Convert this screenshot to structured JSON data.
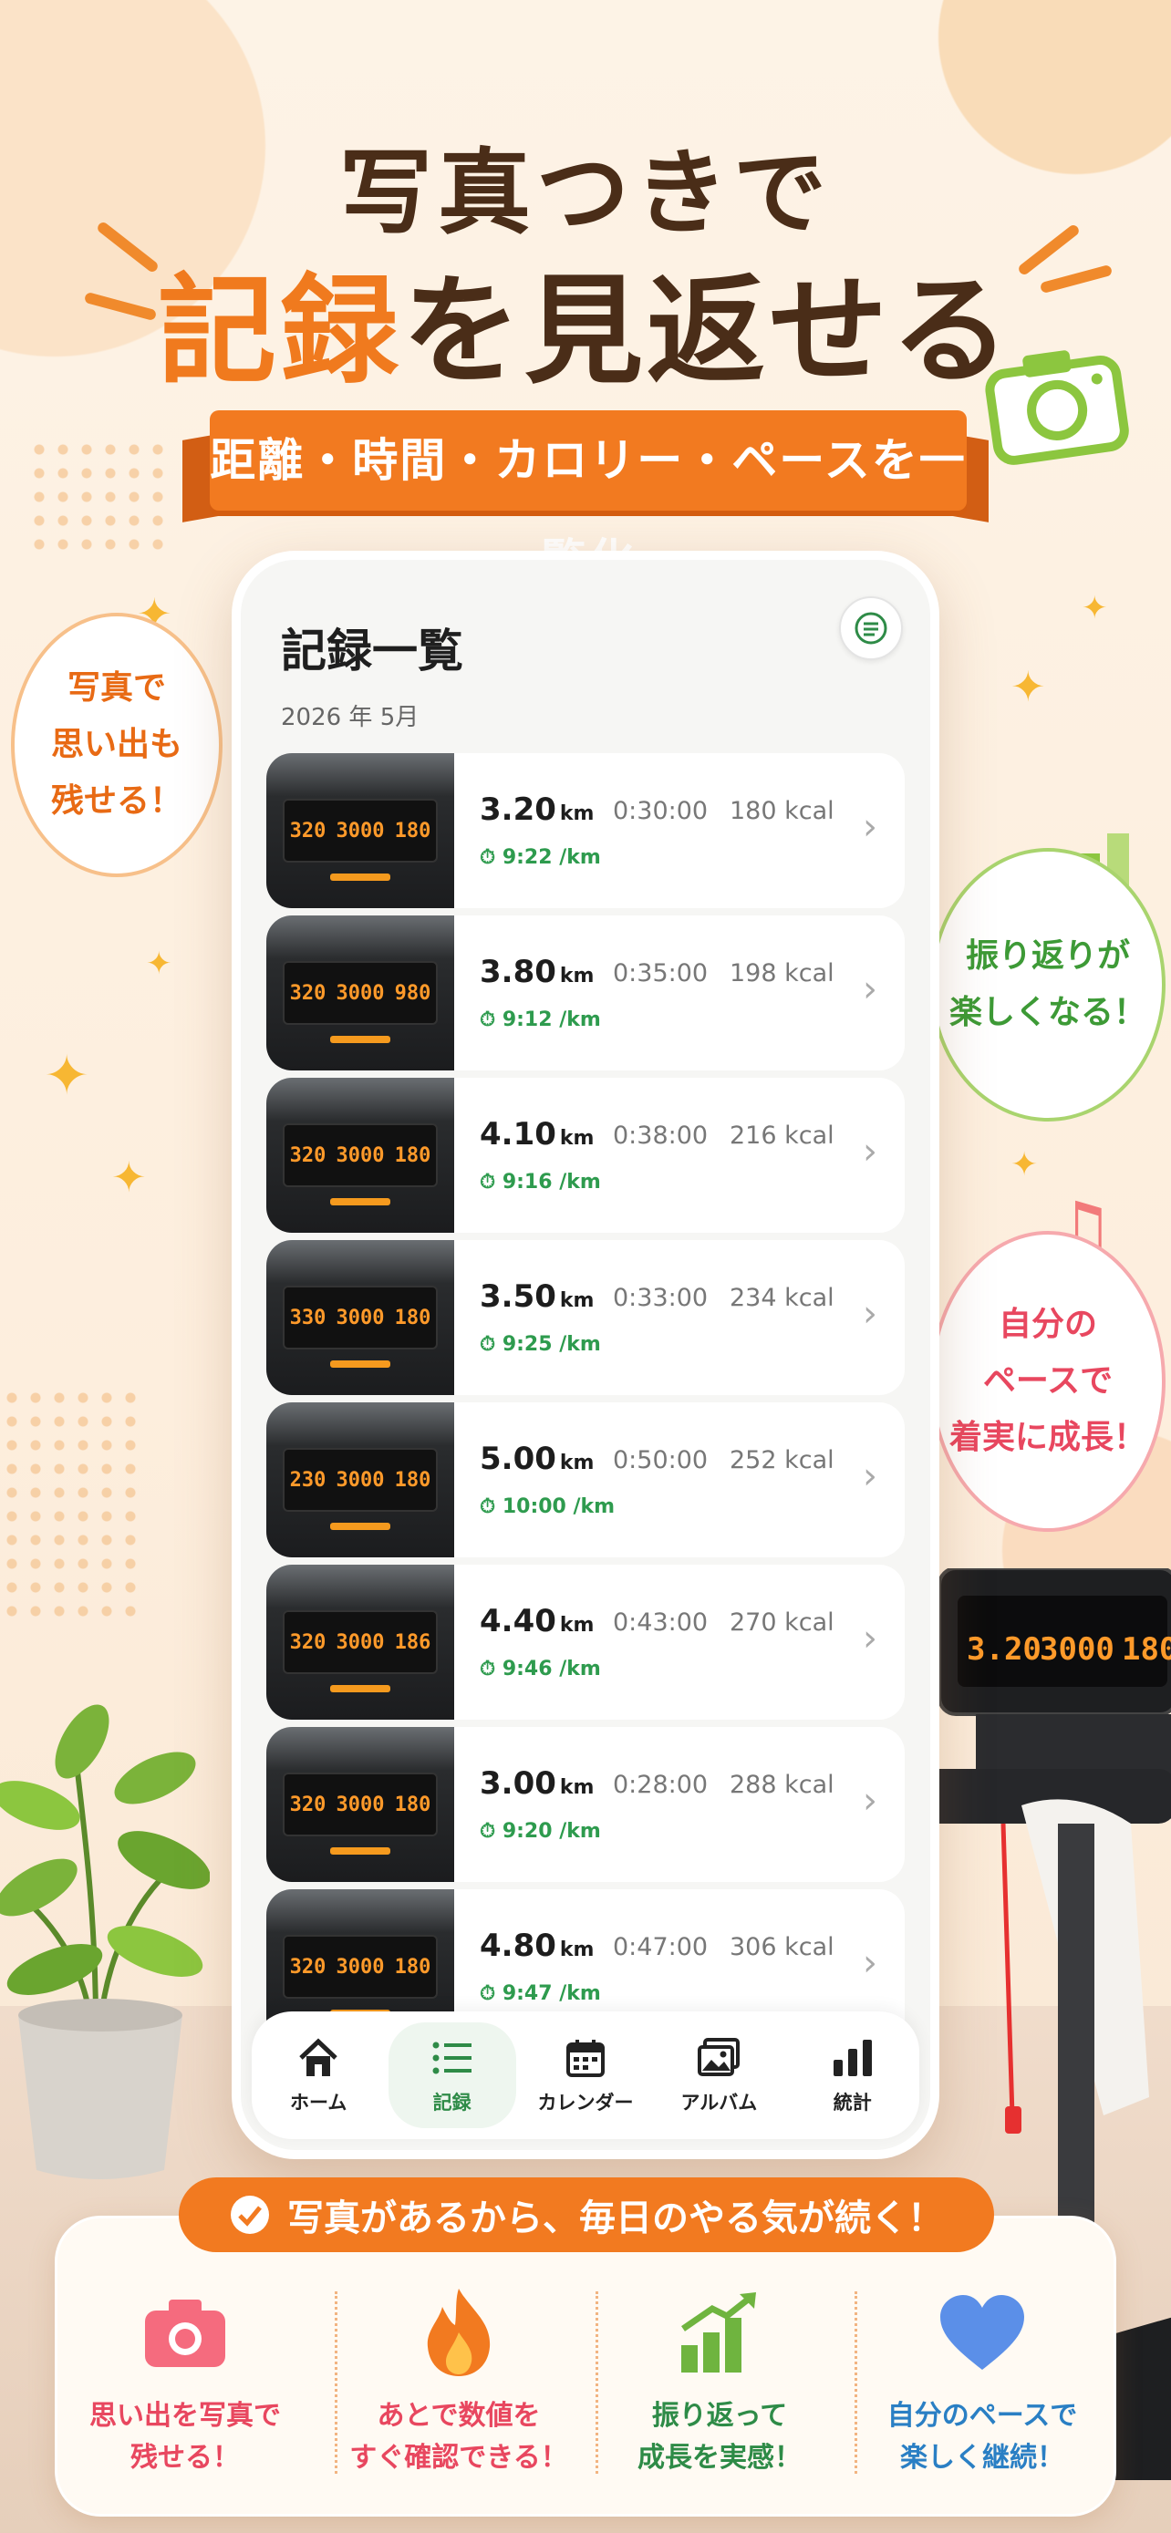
{
  "hero": {
    "line1": "写真つきで",
    "line2_accent": "記録",
    "line2_rest": "を見返せる",
    "ribbon": "距離・時間・カロリー・ペースを一覧化"
  },
  "bubbles": {
    "left": [
      "写真で",
      "思い出も",
      "残せる！"
    ],
    "right_top": [
      "振り返りが",
      "楽しくなる！"
    ],
    "right_bottom": [
      "自分の",
      "ペースで",
      "着実に成長！"
    ]
  },
  "app": {
    "title": "記録一覧",
    "month": "2026 年 5月",
    "records": [
      {
        "distance": "3.20",
        "unit": "km",
        "time": "0:30:00",
        "kcal": "180 kcal",
        "pace": "9:22 /km",
        "panel": [
          "320",
          "3000",
          "180"
        ]
      },
      {
        "distance": "3.80",
        "unit": "km",
        "time": "0:35:00",
        "kcal": "198 kcal",
        "pace": "9:12 /km",
        "panel": [
          "320",
          "3000",
          "980"
        ]
      },
      {
        "distance": "4.10",
        "unit": "km",
        "time": "0:38:00",
        "kcal": "216 kcal",
        "pace": "9:16 /km",
        "panel": [
          "320",
          "3000",
          "180"
        ]
      },
      {
        "distance": "3.50",
        "unit": "km",
        "time": "0:33:00",
        "kcal": "234 kcal",
        "pace": "9:25 /km",
        "panel": [
          "330",
          "3000",
          "180"
        ]
      },
      {
        "distance": "5.00",
        "unit": "km",
        "time": "0:50:00",
        "kcal": "252 kcal",
        "pace": "10:00 /km",
        "panel": [
          "230",
          "3000",
          "180"
        ]
      },
      {
        "distance": "4.40",
        "unit": "km",
        "time": "0:43:00",
        "kcal": "270 kcal",
        "pace": "9:46 /km",
        "panel": [
          "320",
          "3000",
          "186"
        ]
      },
      {
        "distance": "3.00",
        "unit": "km",
        "time": "0:28:00",
        "kcal": "288 kcal",
        "pace": "9:20 /km",
        "panel": [
          "320",
          "3000",
          "180"
        ]
      },
      {
        "distance": "4.80",
        "unit": "km",
        "time": "0:47:00",
        "kcal": "306 kcal",
        "pace": "9:47 /km",
        "panel": [
          "320",
          "3000",
          "180"
        ]
      }
    ],
    "tabs": [
      {
        "label": "ホーム",
        "icon": "home-icon"
      },
      {
        "label": "記録",
        "icon": "list-icon",
        "active": true
      },
      {
        "label": "カレンダー",
        "icon": "calendar-icon"
      },
      {
        "label": "アルバム",
        "icon": "album-icon"
      },
      {
        "label": "統計",
        "icon": "chart-icon"
      }
    ]
  },
  "treadmill_display": [
    "3.20",
    "3000",
    "180"
  ],
  "banner": "写真があるから、毎日のやる気が続く！",
  "features": [
    {
      "lines": [
        "思い出を写真で",
        "残せる！"
      ],
      "color": "#e8475f",
      "icon": "camera-icon"
    },
    {
      "lines": [
        "あとで数値を",
        "すぐ確認できる！"
      ],
      "color": "#e8475f",
      "icon": "flame-icon"
    },
    {
      "lines": [
        "振り返って",
        "成長を実感！"
      ],
      "color": "#2e8b47",
      "icon": "growth-chart-icon"
    },
    {
      "lines": [
        "自分のペースで",
        "楽しく継続！"
      ],
      "color": "#2a7fc4",
      "icon": "heart-icon"
    }
  ],
  "colors": {
    "accent": "#f27a20",
    "green": "#2e9b4e",
    "brown": "#4a2d18"
  }
}
